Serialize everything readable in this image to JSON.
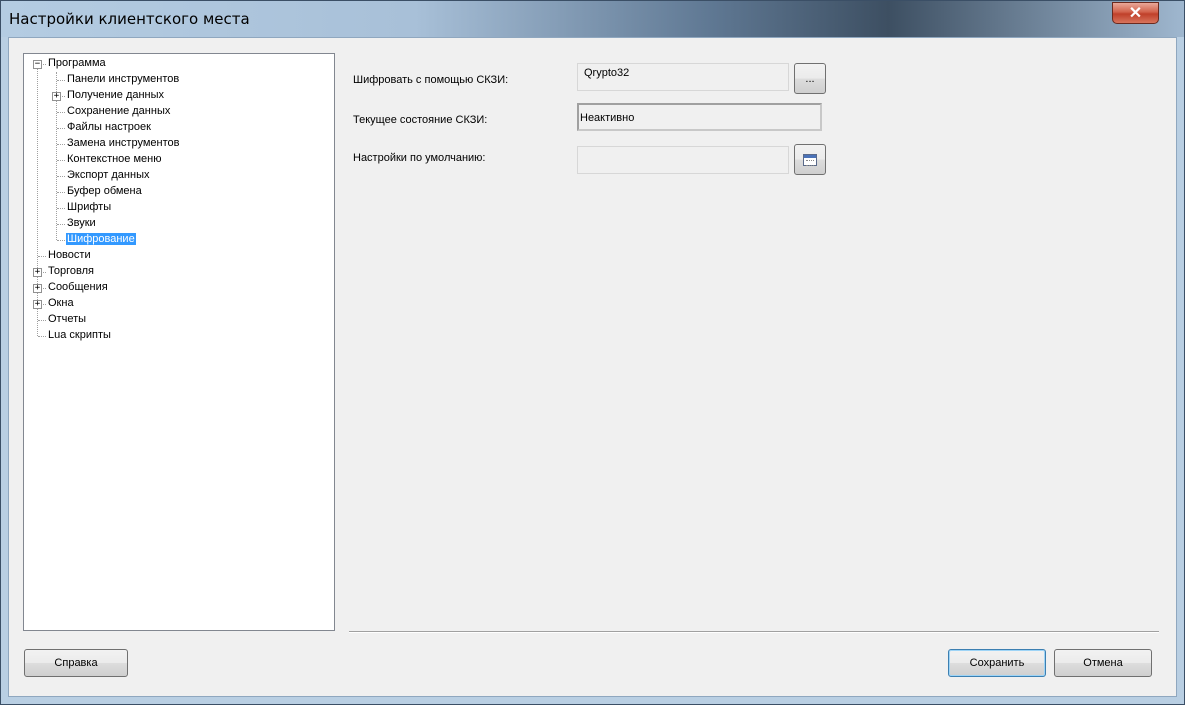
{
  "window": {
    "title": "Настройки клиентского места",
    "close_glyph": "✕"
  },
  "tree": {
    "items": [
      {
        "label": "Программа",
        "level": 0,
        "expander": "−"
      },
      {
        "label": "Панели инструментов",
        "level": 1
      },
      {
        "label": "Получение данных",
        "level": 1,
        "expander": "+"
      },
      {
        "label": "Сохранение данных",
        "level": 1
      },
      {
        "label": "Файлы настроек",
        "level": 1
      },
      {
        "label": "Замена инструментов",
        "level": 1
      },
      {
        "label": "Контекстное меню",
        "level": 1
      },
      {
        "label": "Экспорт данных",
        "level": 1
      },
      {
        "label": "Буфер обмена",
        "level": 1
      },
      {
        "label": "Шрифты",
        "level": 1
      },
      {
        "label": "Звуки",
        "level": 1
      },
      {
        "label": "Шифрование",
        "level": 1,
        "selected": true
      },
      {
        "label": "Новости",
        "level": 0
      },
      {
        "label": "Торговля",
        "level": 0,
        "expander": "+"
      },
      {
        "label": "Сообщения",
        "level": 0,
        "expander": "+"
      },
      {
        "label": "Окна",
        "level": 0,
        "expander": "+"
      },
      {
        "label": "Отчеты",
        "level": 0
      },
      {
        "label": "Lua скрипты",
        "level": 0
      }
    ]
  },
  "settings": {
    "encrypt_label": "Шифровать с помощью СКЗИ:",
    "encrypt_value": "Qrypto32",
    "browse_label": "...",
    "state_label": "Текущее состояние СКЗИ:",
    "state_value": "Неактивно",
    "defaults_label": "Настройки по умолчанию:",
    "defaults_value": "",
    "defaults_icon": "calendar-icon"
  },
  "buttons": {
    "help": "Справка",
    "save": "Сохранить",
    "cancel": "Отмена"
  }
}
